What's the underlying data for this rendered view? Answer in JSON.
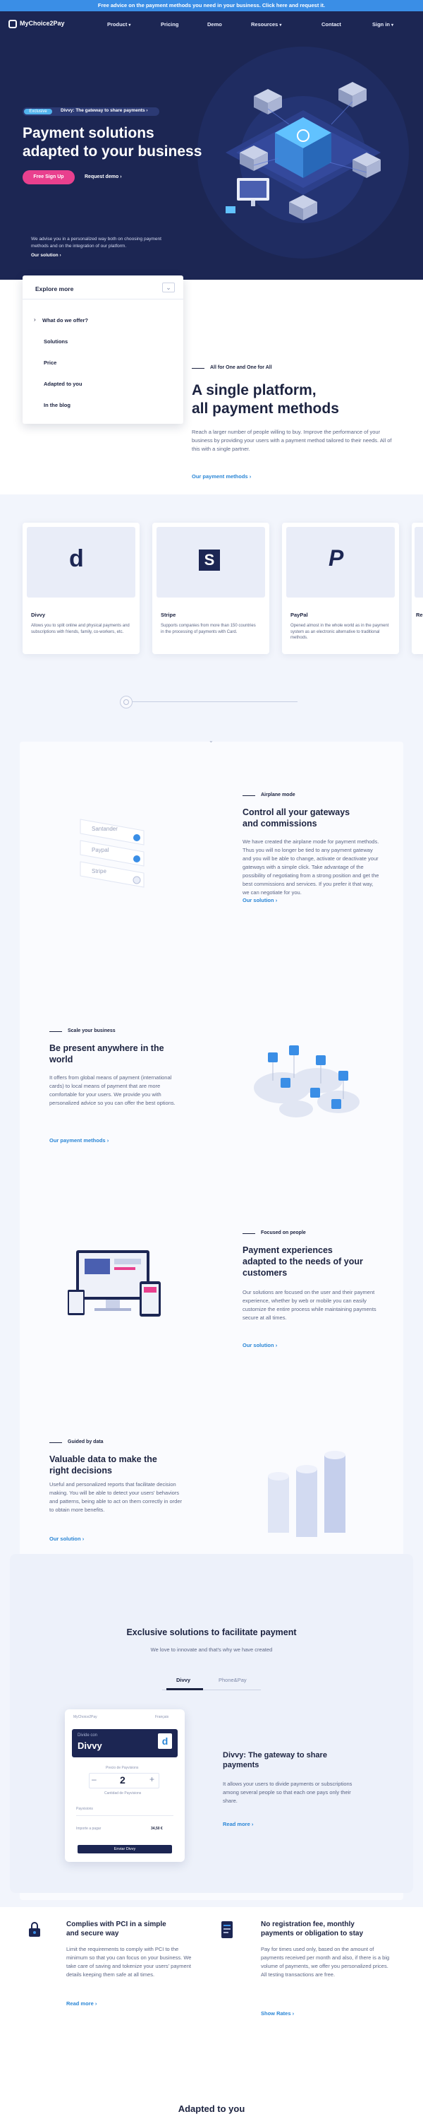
{
  "banner": {
    "text": "Free advice on the payment methods you need in your business. Click here and request it."
  },
  "header": {
    "logo_text": "MyChoice2Pay",
    "nav": [
      {
        "label": "Product",
        "dropdown": true
      },
      {
        "label": "Pricing",
        "dropdown": false
      },
      {
        "label": "Demo",
        "dropdown": false
      },
      {
        "label": "Resources",
        "dropdown": true
      }
    ],
    "contact": "Contact",
    "signin": "Sign in"
  },
  "hero": {
    "tag": "Exclusive",
    "tag_text": "Divvy: The gateway to share payments",
    "title_line1": "Payment solutions",
    "title_line2": "adapted to your business",
    "signup": "Free Sign Up",
    "demo": "Request demo",
    "desc": "We advise you in a personalized way both on choosing payment methods and on the integration of our platform.",
    "link": "Our solution"
  },
  "explore": {
    "title": "Explore more",
    "items": [
      "What do we offer?",
      "Solutions",
      "Price",
      "Adapted to you",
      "In the blog"
    ]
  },
  "platform": {
    "tag": "All for One and One for All",
    "title_line1": "A single platform,",
    "title_line2": "all payment methods",
    "desc": "Reach a larger number of people willing to buy. Improve the performance of your business by providing your users with a payment method tailored to their needs. All of this with a single partner.",
    "link": "Our payment methods"
  },
  "cards": [
    {
      "logo": "d",
      "title": "Divvy",
      "desc": "Allows you to split online and physical payments and subscriptions with friends, family, co-workers, etc."
    },
    {
      "logo": "S",
      "title": "Stripe",
      "desc": "Supports companies from more than 150 countries in the processing of payments with Card."
    },
    {
      "logo": "P",
      "title": "PayPal",
      "desc": "Opened almost in the whole world as in the payment system as an electronic alternative to traditional methods."
    },
    {
      "logo": "",
      "title": "Re",
      "desc": ""
    }
  ],
  "features": [
    {
      "tag": "Airplane mode",
      "title_line1": "Control all your gateways",
      "title_line2": "and commissions",
      "desc": "We have created the airplane mode for payment methods. Thus you will no longer be tied to any payment gateway and you will be able to change, activate or deactivate your gateways with a simple click. Take advantage of the possibility of negotiating from a strong position and get the best commissions and services. If you prefer it that way, we can negotiate for you.",
      "link": "Our solution"
    },
    {
      "tag": "Scale your business",
      "title_line1": "Be present anywhere in the",
      "title_line2": "world",
      "desc": "It offers from global means of payment (international cards) to local means of payment that are more comfortable for your users. We provide you with personalized advice so you can offer the best options.",
      "link": "Our payment methods"
    },
    {
      "tag": "Focused on people",
      "title_line1": "Payment experiences",
      "title_line2": "adapted to the needs of your",
      "title_line3": "customers",
      "desc": "Our solutions are focused on the user and their payment experience, whether by web or mobile you can easily customize the entire process while maintaining payments secure at all times.",
      "link": "Our solution"
    },
    {
      "tag": "Guided by data",
      "title_line1": "Valuable data to make the",
      "title_line2": "right decisions",
      "desc": "Useful and personalized reports that facilitate decision making. You will be able to detect your users' behaviors and patterns, being able to act on them correctly in order to obtain more benefits.",
      "link": "Our solution"
    }
  ],
  "gateways": [
    "Santander",
    "Paypal",
    "Stripe"
  ],
  "exclusive": {
    "title": "Exclusive solutions to facilitate payment",
    "subtitle": "We love to innovate and that's why we have created",
    "tabs": [
      "Divvy",
      "Phone&Pay"
    ],
    "product_title_line1": "Divvy: The gateway to share",
    "product_title_line2": "payments",
    "product_desc": "It allows your users to divide payments or subscriptions among several people so that each one pays only their share.",
    "product_link": "Read more",
    "mock": {
      "brand": "MyChoice2Pay",
      "lang": "Français",
      "head_small": "Divide con",
      "head_big": "Divvy",
      "price_label": "Precio de Payvisions",
      "qty": "2",
      "qty_label": "Cantidad de Payvisions",
      "submit": "Enviar Divvy",
      "row1": "Payvisions",
      "row2": "Importe a pagar",
      "amount": "34,50 €"
    }
  },
  "bottom": [
    {
      "title_line1": "Complies with PCI in a simple",
      "title_line2": "and secure way",
      "desc": "Limit the requirements to comply with PCI to the minimum so that you can focus on your business. We take care of saving and tokenize your users' payment details keeping them safe at all times.",
      "link": "Read more"
    },
    {
      "title_line1": "No registration fee, monthly",
      "title_line2": "payments or obligation to stay",
      "desc": "Pay for times used only, based on the amount of payments received per month and also, if there is a big volume of payments, we offer you personalized prices. All testing transactions are free.",
      "link": "Show Rates"
    }
  ],
  "adapted": {
    "title": "Adapted to you"
  }
}
